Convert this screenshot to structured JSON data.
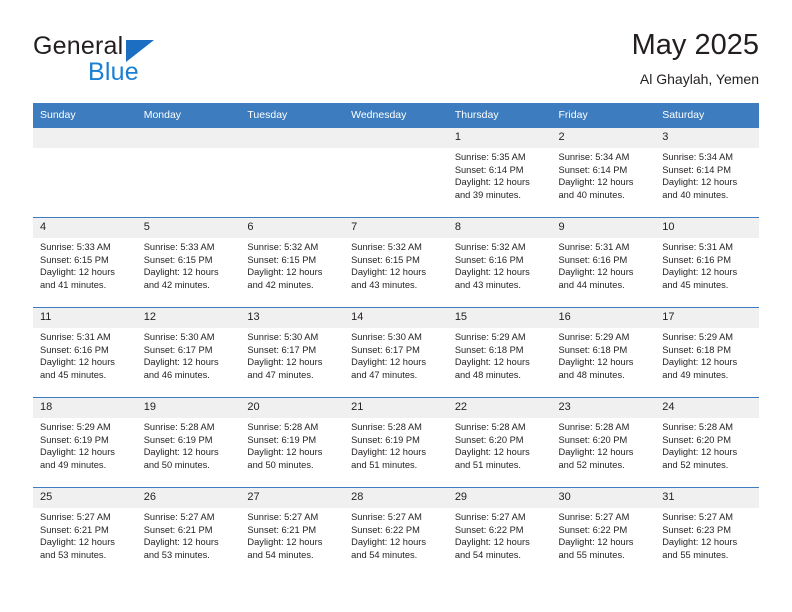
{
  "brand": {
    "name_part1": "General",
    "name_part2": "Blue",
    "logo_icon": "triangle-icon"
  },
  "header": {
    "title": "May 2025",
    "subtitle": "Al Ghaylah, Yemen"
  },
  "colors": {
    "header_blue": "#3d7dbf",
    "brand_blue": "#1b7fd4",
    "daynum_bg": "#f0f0f0",
    "text": "#231f20"
  },
  "columns": [
    "Sunday",
    "Monday",
    "Tuesday",
    "Wednesday",
    "Thursday",
    "Friday",
    "Saturday"
  ],
  "labels": {
    "sunrise_prefix": "Sunrise:",
    "sunset_prefix": "Sunset:",
    "daylight_prefix": "Daylight:"
  },
  "weeks": [
    [
      {
        "day": "",
        "empty": true
      },
      {
        "day": "",
        "empty": true
      },
      {
        "day": "",
        "empty": true
      },
      {
        "day": "",
        "empty": true
      },
      {
        "day": "1",
        "sunrise": "Sunrise: 5:35 AM",
        "sunset": "Sunset: 6:14 PM",
        "daylight_1": "Daylight: 12 hours",
        "daylight_2": "and 39 minutes."
      },
      {
        "day": "2",
        "sunrise": "Sunrise: 5:34 AM",
        "sunset": "Sunset: 6:14 PM",
        "daylight_1": "Daylight: 12 hours",
        "daylight_2": "and 40 minutes."
      },
      {
        "day": "3",
        "sunrise": "Sunrise: 5:34 AM",
        "sunset": "Sunset: 6:14 PM",
        "daylight_1": "Daylight: 12 hours",
        "daylight_2": "and 40 minutes."
      }
    ],
    [
      {
        "day": "4",
        "sunrise": "Sunrise: 5:33 AM",
        "sunset": "Sunset: 6:15 PM",
        "daylight_1": "Daylight: 12 hours",
        "daylight_2": "and 41 minutes."
      },
      {
        "day": "5",
        "sunrise": "Sunrise: 5:33 AM",
        "sunset": "Sunset: 6:15 PM",
        "daylight_1": "Daylight: 12 hours",
        "daylight_2": "and 42 minutes."
      },
      {
        "day": "6",
        "sunrise": "Sunrise: 5:32 AM",
        "sunset": "Sunset: 6:15 PM",
        "daylight_1": "Daylight: 12 hours",
        "daylight_2": "and 42 minutes."
      },
      {
        "day": "7",
        "sunrise": "Sunrise: 5:32 AM",
        "sunset": "Sunset: 6:15 PM",
        "daylight_1": "Daylight: 12 hours",
        "daylight_2": "and 43 minutes."
      },
      {
        "day": "8",
        "sunrise": "Sunrise: 5:32 AM",
        "sunset": "Sunset: 6:16 PM",
        "daylight_1": "Daylight: 12 hours",
        "daylight_2": "and 43 minutes."
      },
      {
        "day": "9",
        "sunrise": "Sunrise: 5:31 AM",
        "sunset": "Sunset: 6:16 PM",
        "daylight_1": "Daylight: 12 hours",
        "daylight_2": "and 44 minutes."
      },
      {
        "day": "10",
        "sunrise": "Sunrise: 5:31 AM",
        "sunset": "Sunset: 6:16 PM",
        "daylight_1": "Daylight: 12 hours",
        "daylight_2": "and 45 minutes."
      }
    ],
    [
      {
        "day": "11",
        "sunrise": "Sunrise: 5:31 AM",
        "sunset": "Sunset: 6:16 PM",
        "daylight_1": "Daylight: 12 hours",
        "daylight_2": "and 45 minutes."
      },
      {
        "day": "12",
        "sunrise": "Sunrise: 5:30 AM",
        "sunset": "Sunset: 6:17 PM",
        "daylight_1": "Daylight: 12 hours",
        "daylight_2": "and 46 minutes."
      },
      {
        "day": "13",
        "sunrise": "Sunrise: 5:30 AM",
        "sunset": "Sunset: 6:17 PM",
        "daylight_1": "Daylight: 12 hours",
        "daylight_2": "and 47 minutes."
      },
      {
        "day": "14",
        "sunrise": "Sunrise: 5:30 AM",
        "sunset": "Sunset: 6:17 PM",
        "daylight_1": "Daylight: 12 hours",
        "daylight_2": "and 47 minutes."
      },
      {
        "day": "15",
        "sunrise": "Sunrise: 5:29 AM",
        "sunset": "Sunset: 6:18 PM",
        "daylight_1": "Daylight: 12 hours",
        "daylight_2": "and 48 minutes."
      },
      {
        "day": "16",
        "sunrise": "Sunrise: 5:29 AM",
        "sunset": "Sunset: 6:18 PM",
        "daylight_1": "Daylight: 12 hours",
        "daylight_2": "and 48 minutes."
      },
      {
        "day": "17",
        "sunrise": "Sunrise: 5:29 AM",
        "sunset": "Sunset: 6:18 PM",
        "daylight_1": "Daylight: 12 hours",
        "daylight_2": "and 49 minutes."
      }
    ],
    [
      {
        "day": "18",
        "sunrise": "Sunrise: 5:29 AM",
        "sunset": "Sunset: 6:19 PM",
        "daylight_1": "Daylight: 12 hours",
        "daylight_2": "and 49 minutes."
      },
      {
        "day": "19",
        "sunrise": "Sunrise: 5:28 AM",
        "sunset": "Sunset: 6:19 PM",
        "daylight_1": "Daylight: 12 hours",
        "daylight_2": "and 50 minutes."
      },
      {
        "day": "20",
        "sunrise": "Sunrise: 5:28 AM",
        "sunset": "Sunset: 6:19 PM",
        "daylight_1": "Daylight: 12 hours",
        "daylight_2": "and 50 minutes."
      },
      {
        "day": "21",
        "sunrise": "Sunrise: 5:28 AM",
        "sunset": "Sunset: 6:19 PM",
        "daylight_1": "Daylight: 12 hours",
        "daylight_2": "and 51 minutes."
      },
      {
        "day": "22",
        "sunrise": "Sunrise: 5:28 AM",
        "sunset": "Sunset: 6:20 PM",
        "daylight_1": "Daylight: 12 hours",
        "daylight_2": "and 51 minutes."
      },
      {
        "day": "23",
        "sunrise": "Sunrise: 5:28 AM",
        "sunset": "Sunset: 6:20 PM",
        "daylight_1": "Daylight: 12 hours",
        "daylight_2": "and 52 minutes."
      },
      {
        "day": "24",
        "sunrise": "Sunrise: 5:28 AM",
        "sunset": "Sunset: 6:20 PM",
        "daylight_1": "Daylight: 12 hours",
        "daylight_2": "and 52 minutes."
      }
    ],
    [
      {
        "day": "25",
        "sunrise": "Sunrise: 5:27 AM",
        "sunset": "Sunset: 6:21 PM",
        "daylight_1": "Daylight: 12 hours",
        "daylight_2": "and 53 minutes."
      },
      {
        "day": "26",
        "sunrise": "Sunrise: 5:27 AM",
        "sunset": "Sunset: 6:21 PM",
        "daylight_1": "Daylight: 12 hours",
        "daylight_2": "and 53 minutes."
      },
      {
        "day": "27",
        "sunrise": "Sunrise: 5:27 AM",
        "sunset": "Sunset: 6:21 PM",
        "daylight_1": "Daylight: 12 hours",
        "daylight_2": "and 54 minutes."
      },
      {
        "day": "28",
        "sunrise": "Sunrise: 5:27 AM",
        "sunset": "Sunset: 6:22 PM",
        "daylight_1": "Daylight: 12 hours",
        "daylight_2": "and 54 minutes."
      },
      {
        "day": "29",
        "sunrise": "Sunrise: 5:27 AM",
        "sunset": "Sunset: 6:22 PM",
        "daylight_1": "Daylight: 12 hours",
        "daylight_2": "and 54 minutes."
      },
      {
        "day": "30",
        "sunrise": "Sunrise: 5:27 AM",
        "sunset": "Sunset: 6:22 PM",
        "daylight_1": "Daylight: 12 hours",
        "daylight_2": "and 55 minutes."
      },
      {
        "day": "31",
        "sunrise": "Sunrise: 5:27 AM",
        "sunset": "Sunset: 6:23 PM",
        "daylight_1": "Daylight: 12 hours",
        "daylight_2": "and 55 minutes."
      }
    ]
  ]
}
